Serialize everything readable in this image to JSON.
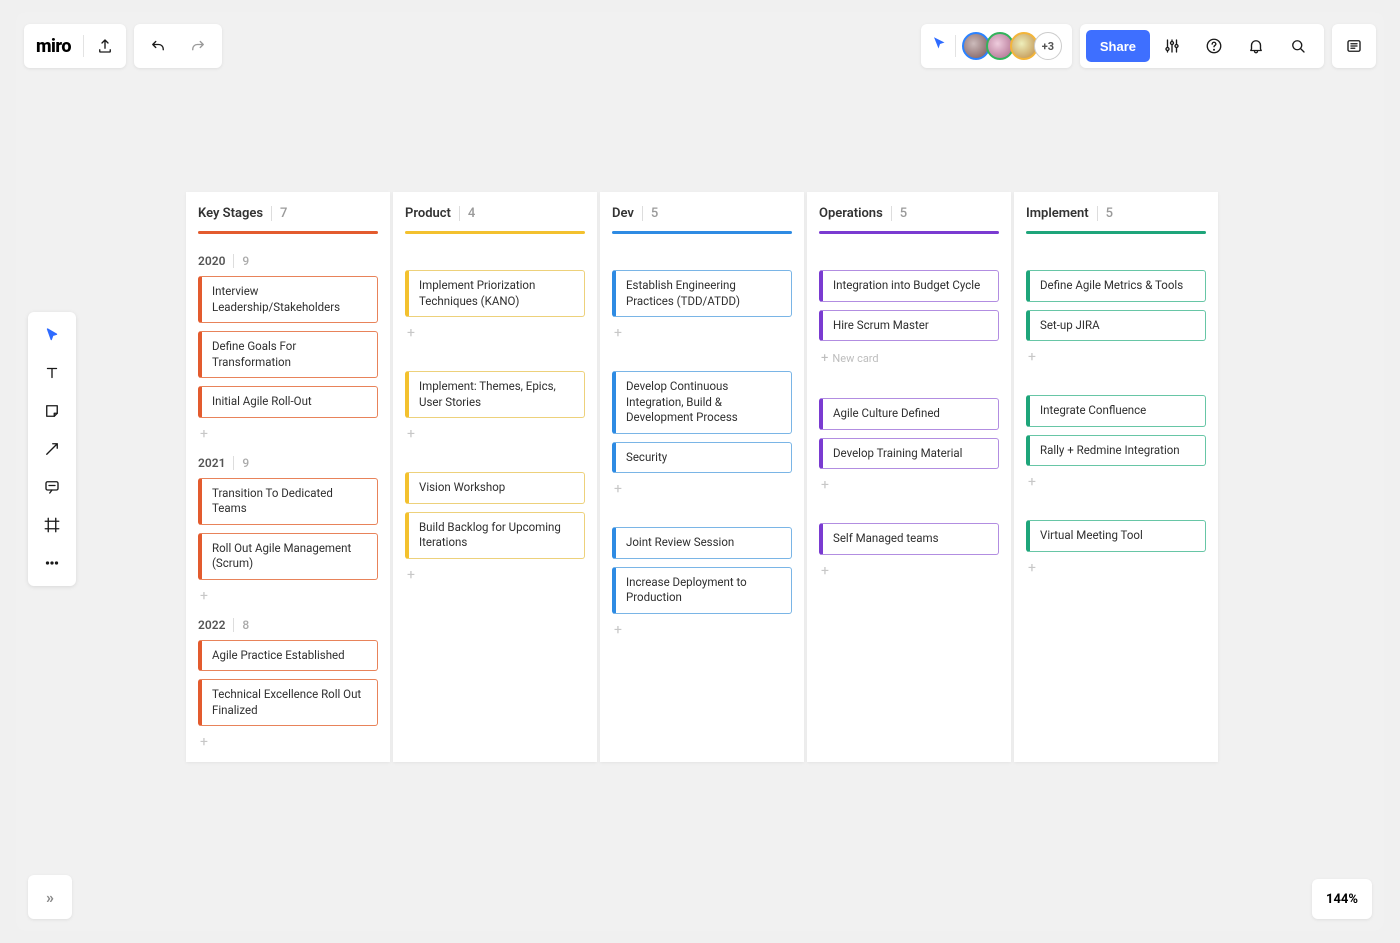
{
  "app": {
    "name": "miro"
  },
  "collaborators": {
    "more_count": "+3"
  },
  "actions": {
    "share": "Share"
  },
  "zoom": "144%",
  "new_card_label": "New card",
  "columns": [
    {
      "key": "keystages",
      "title": "Key Stages",
      "count": 7
    },
    {
      "key": "product",
      "title": "Product",
      "count": 4
    },
    {
      "key": "dev",
      "title": "Dev",
      "count": 5
    },
    {
      "key": "operations",
      "title": "Operations",
      "count": 5
    },
    {
      "key": "implement",
      "title": "Implement",
      "count": 5
    }
  ],
  "swimlanes": [
    {
      "year": "2020",
      "count": 9
    },
    {
      "year": "2021",
      "count": 9
    },
    {
      "year": "2022",
      "count": 8
    }
  ],
  "cards": {
    "keystages": {
      "2020": [
        "Interview Leadership/Stakeholders",
        "Define Goals For Transformation",
        "Initial Agile Roll-Out"
      ],
      "2021": [
        "Transition To Dedicated Teams",
        "Roll Out Agile Management (Scrum)"
      ],
      "2022": [
        "Agile Practice Established",
        "Technical Excellence Roll Out Finalized"
      ]
    },
    "product": {
      "2020": [
        "Implement Priorization Techniques (KANO)"
      ],
      "2021": [
        "Implement: Themes, Epics, User Stories"
      ],
      "2022": [
        "Vision Workshop",
        "Build Backlog for Upcoming Iterations"
      ]
    },
    "dev": {
      "2020": [
        "Establish Engineering Practices (TDD/ATDD)"
      ],
      "2021": [
        "Develop Continuous Integration, Build & Development Process",
        "Security"
      ],
      "2022": [
        "Joint Review Session",
        "Increase Deployment to Production"
      ]
    },
    "operations": {
      "2020": [
        "Integration into Budget Cycle",
        "Hire Scrum Master"
      ],
      "2021": [
        "Agile Culture Defined",
        "Develop Training Material"
      ],
      "2022": [
        "Self Managed teams"
      ]
    },
    "implement": {
      "2020": [
        "Define Agile Metrics & Tools",
        "Set-up JIRA"
      ],
      "2021": [
        "Integrate Confluence",
        "Rally + Redmine Integration"
      ],
      "2022": [
        "Virtual Meeting Tool"
      ]
    }
  }
}
